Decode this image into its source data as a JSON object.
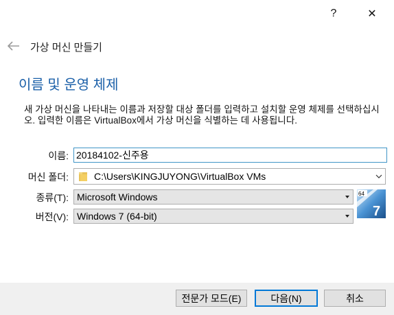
{
  "titlebar": {
    "help_label": "?",
    "close_label": "✕"
  },
  "wizard": {
    "back_icon": "back-arrow-icon",
    "title": "가상 머신 만들기"
  },
  "section": {
    "title": "이름 및 운영 체제",
    "description": "새 가상 머신을 나타내는 이름과 저장할 대상 폴더를 입력하고 설치할 운영 체제를 선택하십시오. 입력한 이름은 VirtualBox에서 가상 머신을 식별하는 데 사용됩니다."
  },
  "form": {
    "name_label": "이름:",
    "name_value": "20184102-신주용",
    "folder_label": "머신 폴더:",
    "folder_value": "C:\\Users\\KINGJUYONG\\VirtualBox VMs",
    "type_label": "종류(T):",
    "type_value": "Microsoft Windows",
    "version_label": "버전(V):",
    "version_value": "Windows 7 (64-bit)",
    "os_icon_badge": "64",
    "os_icon_number": "7"
  },
  "buttons": {
    "expert": "전문가 모드(E)",
    "next": "다음(N)",
    "cancel": "취소"
  },
  "colors": {
    "accent": "#1a5fa8",
    "focus": "#3f94c6",
    "default_button": "#0078d7"
  }
}
